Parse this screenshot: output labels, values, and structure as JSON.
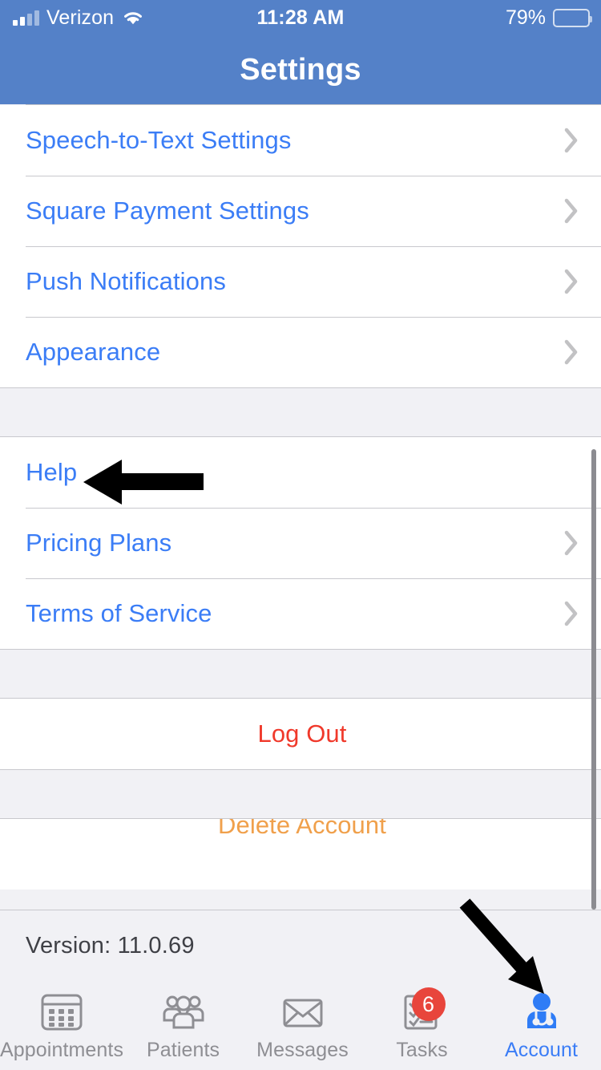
{
  "status_bar": {
    "carrier": "Verizon",
    "time": "11:28 AM",
    "battery_percent": "79%",
    "battery_level": 79,
    "signal_icon": "cellular-signal-icon",
    "wifi_icon": "wifi-icon",
    "battery_icon": "battery-icon"
  },
  "nav": {
    "title": "Settings"
  },
  "colors": {
    "nav_bar": "#5481c8",
    "link_blue": "#3b7df6",
    "destructive_red": "#f0392b",
    "warning_orange": "#f0a04b",
    "badge_red": "#e8453c",
    "group_background": "#f1f1f5",
    "separator": "#c8c8cd",
    "inactive_tab": "#8e8e93"
  },
  "sections": [
    {
      "rows": [
        {
          "label": "Speech-to-Text Settings",
          "accessory": "chevron-right-icon",
          "style": "link"
        },
        {
          "label": "Square Payment Settings",
          "accessory": "chevron-right-icon",
          "style": "link"
        },
        {
          "label": "Push Notifications",
          "accessory": "chevron-right-icon",
          "style": "link"
        },
        {
          "label": "Appearance",
          "accessory": "chevron-right-icon",
          "style": "link"
        }
      ]
    },
    {
      "rows": [
        {
          "label": "Help",
          "accessory": "none",
          "style": "link"
        },
        {
          "label": "Pricing Plans",
          "accessory": "chevron-right-icon",
          "style": "link"
        },
        {
          "label": "Terms of Service",
          "accessory": "chevron-right-icon",
          "style": "link"
        }
      ]
    },
    {
      "rows": [
        {
          "label": "Log Out",
          "accessory": "none",
          "style": "destructive"
        }
      ]
    },
    {
      "rows": [
        {
          "label": "Delete Account",
          "accessory": "none",
          "style": "warn"
        }
      ]
    }
  ],
  "footer": {
    "version": "Version: 11.0.69"
  },
  "tabs": [
    {
      "label": "Appointments",
      "icon": "calendar-icon",
      "active": false,
      "badge": ""
    },
    {
      "label": "Patients",
      "icon": "people-group-icon",
      "active": false,
      "badge": ""
    },
    {
      "label": "Messages",
      "icon": "envelope-icon",
      "active": false,
      "badge": ""
    },
    {
      "label": "Tasks",
      "icon": "checklist-icon",
      "active": false,
      "badge": "6"
    },
    {
      "label": "Account",
      "icon": "doctor-stethoscope-icon",
      "active": true,
      "badge": ""
    }
  ],
  "annotations": [
    {
      "name": "arrow-pointing-to-help",
      "shape": "left-arrow"
    },
    {
      "name": "arrow-pointing-to-account-tab",
      "shape": "diagonal-arrow"
    }
  ]
}
